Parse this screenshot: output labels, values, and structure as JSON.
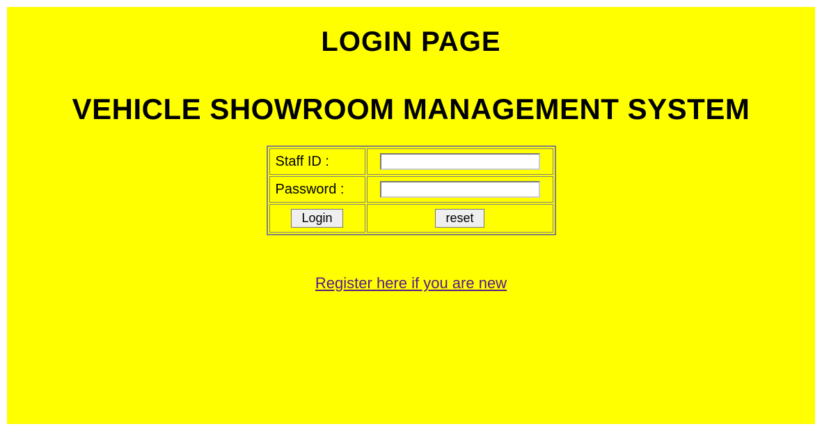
{
  "header": {
    "title": "LOGIN PAGE",
    "subtitle": "VEHICLE SHOWROOM MANAGEMENT SYSTEM"
  },
  "form": {
    "staff_id_label": "Staff ID :",
    "password_label": "Password :",
    "staff_id_value": "",
    "password_value": "",
    "login_button_label": "Login",
    "reset_button_label": "reset"
  },
  "footer": {
    "register_link_text": "Register here if you are new"
  }
}
